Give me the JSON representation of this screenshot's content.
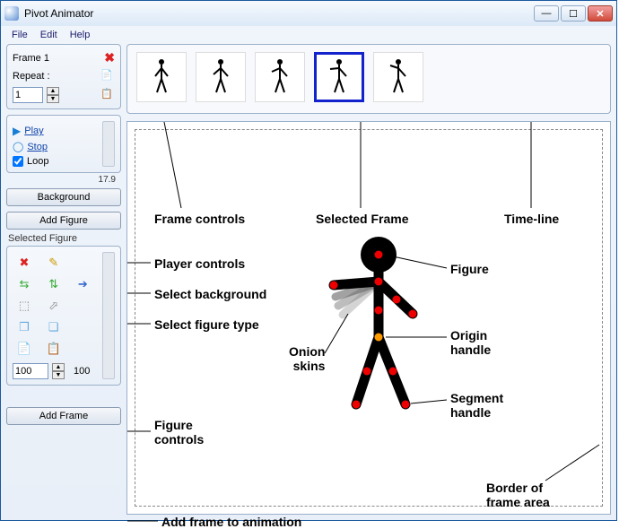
{
  "app": {
    "title": "Pivot Animator"
  },
  "menu": {
    "file": "File",
    "edit": "Edit",
    "help": "Help"
  },
  "winbtn": {
    "min": "—",
    "max": "☐",
    "close": "✕"
  },
  "frame_panel": {
    "title": "Frame 1",
    "repeat_label": "Repeat :",
    "repeat_value": "1",
    "delete_icon": "delete-icon",
    "copy_icon": "copy-icon",
    "paste_icon": "paste-icon"
  },
  "player": {
    "play": "Play",
    "stop": "Stop",
    "loop": "Loop",
    "fps": "17.9"
  },
  "buttons": {
    "background": "Background",
    "add_figure": "Add Figure",
    "add_frame": "Add Frame"
  },
  "selected_figure": {
    "label": "Selected Figure",
    "size_value": "100",
    "size_display": "100"
  },
  "tools": {
    "t0": "✖",
    "t1": "✎",
    "t2": " ",
    "t3": "⇆",
    "t4": "⇅",
    "t5": "➔",
    "t6": "⬚",
    "t7": "⬀",
    "t8": " ",
    "t9": "❐",
    "t10": "❏",
    "t11": " ",
    "t12": "📄",
    "t13": "📋",
    "t14": " "
  },
  "timeline": {
    "frames": [
      {
        "pose": 0,
        "selected": false
      },
      {
        "pose": 1,
        "selected": false
      },
      {
        "pose": 2,
        "selected": false
      },
      {
        "pose": 3,
        "selected": true
      },
      {
        "pose": 4,
        "selected": false
      }
    ]
  },
  "annotations": {
    "frame_controls": "Frame controls",
    "selected_frame": "Selected Frame",
    "timeline": "Time-line",
    "player_controls": "Player controls",
    "select_background": "Select background",
    "select_figure_type": "Select figure type",
    "figure_controls": "Figure\ncontrols",
    "add_frame_anno": "Add frame to animation",
    "figure": "Figure",
    "origin_handle": "Origin\nhandle",
    "onion_skins": "Onion\nskins",
    "segment_handle": "Segment\nhandle",
    "border_frame": "Border of\nframe area"
  }
}
